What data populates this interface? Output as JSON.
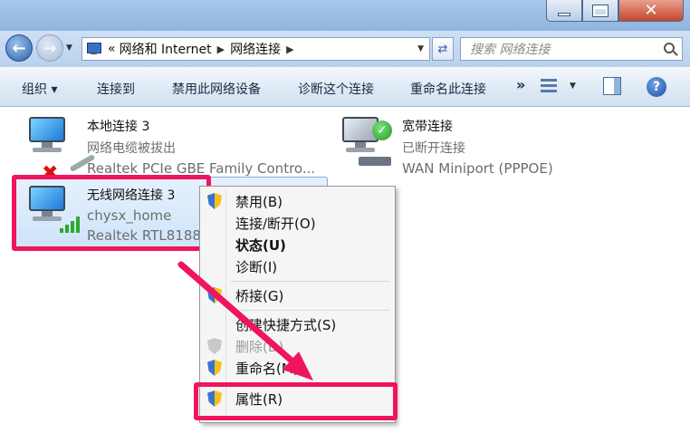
{
  "window": {
    "close_glyph": "✕"
  },
  "address": {
    "prefix": "«",
    "crumbs": [
      "网络和 Internet",
      "网络连接"
    ],
    "search_placeholder": "搜索 网络连接"
  },
  "toolbar": {
    "organize": "组织 ▾",
    "connect_to": "连接到",
    "disable_device": "禁用此网络设备",
    "diagnose": "诊断这个连接",
    "rename": "重命名此连接",
    "more": "»",
    "help": "?"
  },
  "connections": [
    {
      "name": "本地连接 3",
      "status": "网络电缆被拔出",
      "adapter": "Realtek PCIe GBE Family Contro..."
    },
    {
      "name": "宽带连接",
      "status": "已断开连接",
      "adapter": "WAN Miniport (PPPOE)"
    },
    {
      "name": "无线网络连接 3",
      "status": "chysx_home",
      "adapter": "Realtek RTL8188"
    }
  ],
  "context_menu": {
    "items": [
      {
        "label": "禁用(B)",
        "icon": "shield-icon"
      },
      {
        "label": "连接/断开(O)",
        "icon": ""
      },
      {
        "label": "状态(U)",
        "icon": "",
        "bold": true
      },
      {
        "label": "诊断(I)",
        "icon": ""
      },
      {
        "label": "桥接(G)",
        "icon": "shield-icon"
      },
      {
        "label": "创建快捷方式(S)",
        "icon": ""
      },
      {
        "label": "删除(D)",
        "icon": "shield-icon",
        "disabled": true
      },
      {
        "label": "重命名(M)",
        "icon": "shield-icon"
      },
      {
        "label": "属性(R)",
        "icon": "shield-icon"
      }
    ]
  },
  "colors": {
    "highlight": "#f0145e",
    "selection": "#cfe4fa"
  }
}
